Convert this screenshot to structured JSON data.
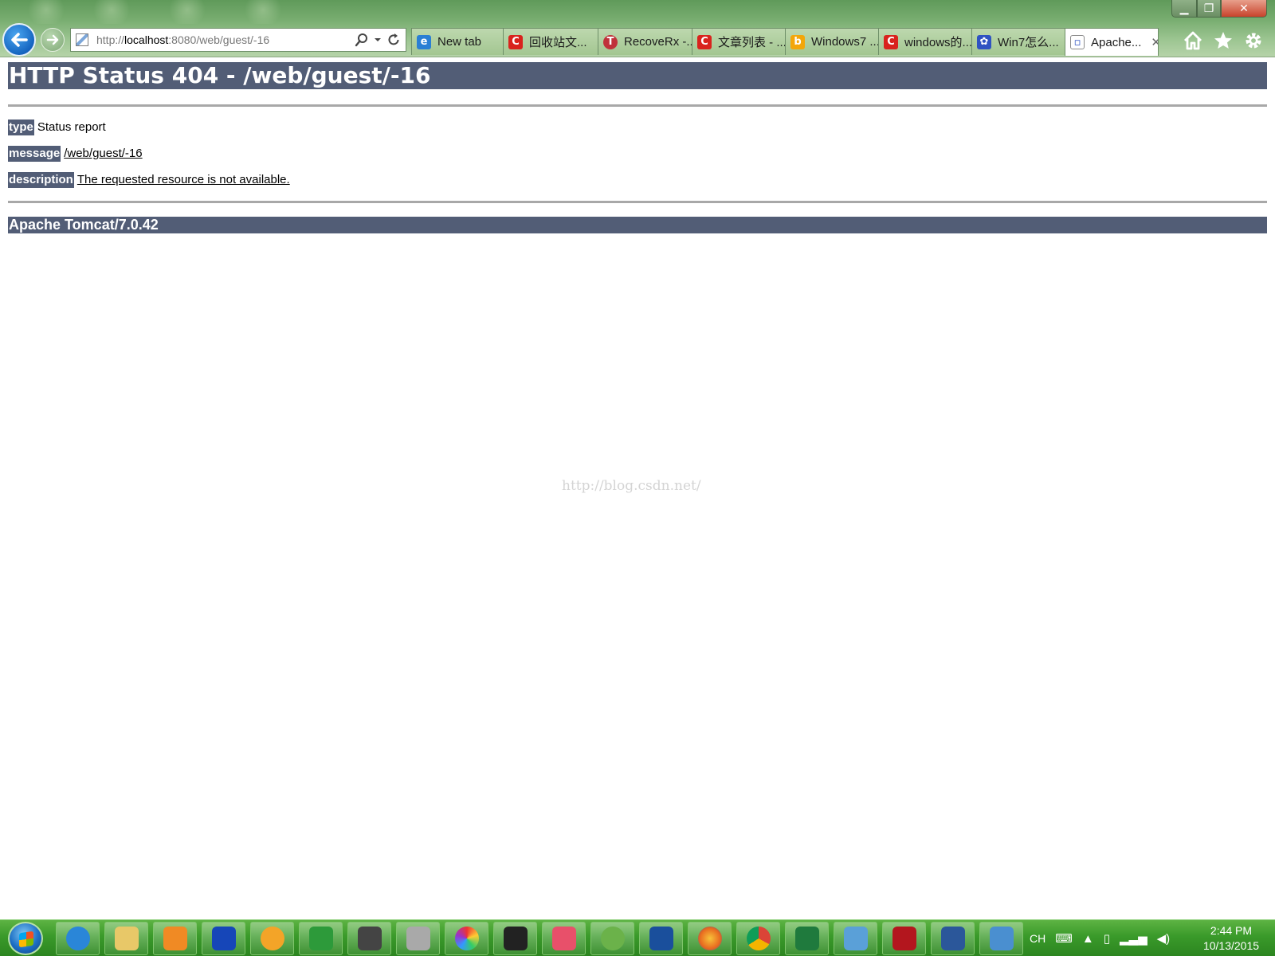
{
  "browser": {
    "address_url_prefix": "http://",
    "address_url_host": "localhost",
    "address_url_rest": ":8080/web/guest/-16",
    "tabs": [
      {
        "label": "New tab",
        "fav_color": "#2a7fd4",
        "fav_glyph": "e"
      },
      {
        "label": "回收站文...",
        "fav_color": "#d9231d",
        "fav_glyph": "C"
      },
      {
        "label": "RecoveRx -...",
        "fav_color": "#c0323a",
        "fav_glyph": "T"
      },
      {
        "label": "文章列表 - ...",
        "fav_color": "#d9231d",
        "fav_glyph": "C"
      },
      {
        "label": "Windows7 ...",
        "fav_color": "#f3a60a",
        "fav_glyph": "b"
      },
      {
        "label": "windows的...",
        "fav_color": "#d9231d",
        "fav_glyph": "C"
      },
      {
        "label": "Win7怎么...",
        "fav_color": "#2f53c2",
        "fav_glyph": "✿"
      },
      {
        "label": "Apache...",
        "fav_color": "#6d8fc4",
        "fav_glyph": "▫"
      }
    ],
    "tab_close_glyph": "✕"
  },
  "page": {
    "title": "HTTP Status 404 - /web/guest/-16",
    "type_label": "type",
    "type_value": "Status report",
    "message_label": "message",
    "message_value": "/web/guest/-16",
    "description_label": "description",
    "description_value": "The requested resource is not available.",
    "footer": "Apache Tomcat/7.0.42",
    "watermark": "http://blog.csdn.net/"
  },
  "taskbar": {
    "apps": [
      {
        "name": "internet-explorer",
        "color": "#2a86d8"
      },
      {
        "name": "file-explorer",
        "color": "#e8c868"
      },
      {
        "name": "media-player",
        "color": "#f08a24"
      },
      {
        "name": "blue-app",
        "color": "#1646b8"
      },
      {
        "name": "orange-app",
        "color": "#f3a428"
      },
      {
        "name": "green-app",
        "color": "#2d9a3a"
      },
      {
        "name": "hypercam",
        "color": "#444444"
      },
      {
        "name": "drive-lock",
        "color": "#a9a9a9"
      },
      {
        "name": "color-wheel",
        "color": "#9c5ac4"
      },
      {
        "name": "dxo-viewpoint",
        "color": "#222222"
      },
      {
        "name": "pink-app",
        "color": "#e8506a"
      },
      {
        "name": "toad",
        "color": "#6bb24a"
      },
      {
        "name": "split-app",
        "color": "#1a4f9c"
      },
      {
        "name": "firefox",
        "color": "#e86a1f"
      },
      {
        "name": "chrome",
        "color": "#e9b31d"
      },
      {
        "name": "excel",
        "color": "#1f7a3d"
      },
      {
        "name": "paint",
        "color": "#5aa0d8"
      },
      {
        "name": "acrobat",
        "color": "#b3161e"
      },
      {
        "name": "word",
        "color": "#2b579a"
      },
      {
        "name": "remote-desktop",
        "color": "#4a8fd0"
      }
    ],
    "lang": "CH",
    "time": "2:44 PM",
    "date": "10/13/2015"
  },
  "colors": {
    "tomcat_header": "#525d76",
    "taskbar": "#3a9a2a"
  }
}
